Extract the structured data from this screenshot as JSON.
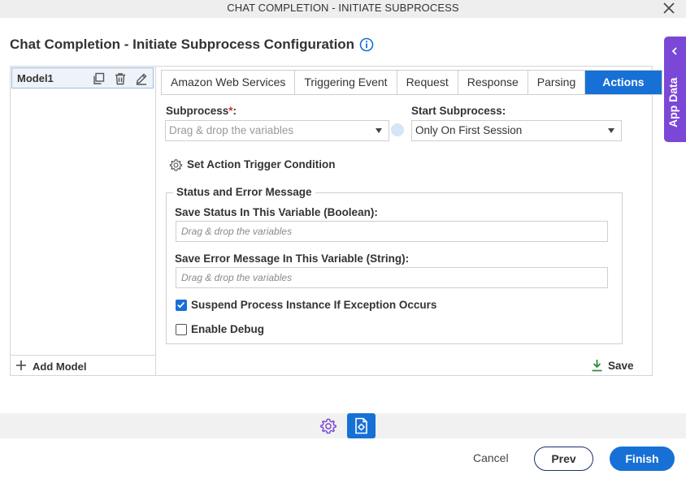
{
  "window": {
    "title": "CHAT COMPLETION - INITIATE SUBPROCESS"
  },
  "page": {
    "title": "Chat Completion - Initiate Subprocess Configuration"
  },
  "models": {
    "items": [
      {
        "label": "Model1"
      }
    ],
    "add_label": "Add Model"
  },
  "tabs": [
    {
      "label": "Amazon Web Services"
    },
    {
      "label": "Triggering Event"
    },
    {
      "label": "Request"
    },
    {
      "label": "Response"
    },
    {
      "label": "Parsing"
    },
    {
      "label": "Actions",
      "active": true
    }
  ],
  "form": {
    "subprocess": {
      "label": "Subprocess",
      "required_mark": "*",
      "colon": ":",
      "placeholder": "Drag & drop the variables"
    },
    "start_subprocess": {
      "label": "Start Subprocess:",
      "value": "Only On First Session"
    },
    "trigger_condition_label": "Set Action Trigger Condition",
    "status_group": {
      "legend": "Status and Error Message",
      "status_var": {
        "label": "Save Status In This Variable (Boolean):",
        "placeholder": "Drag & drop the variables"
      },
      "error_var": {
        "label": "Save Error Message In This Variable (String):",
        "placeholder": "Drag & drop the variables"
      }
    },
    "suspend_on_exception": {
      "label": "Suspend Process Instance If Exception Occurs",
      "checked": true
    },
    "enable_debug": {
      "label": "Enable Debug",
      "checked": false
    },
    "save_label": "Save"
  },
  "side_panel": {
    "label": "App Data"
  },
  "footer": {
    "cancel": "Cancel",
    "prev": "Prev",
    "finish": "Finish"
  },
  "colors": {
    "accent": "#1670d6",
    "app_data": "#7b47d6",
    "required": "#d9262d",
    "save_icon": "#2e8b3c"
  }
}
